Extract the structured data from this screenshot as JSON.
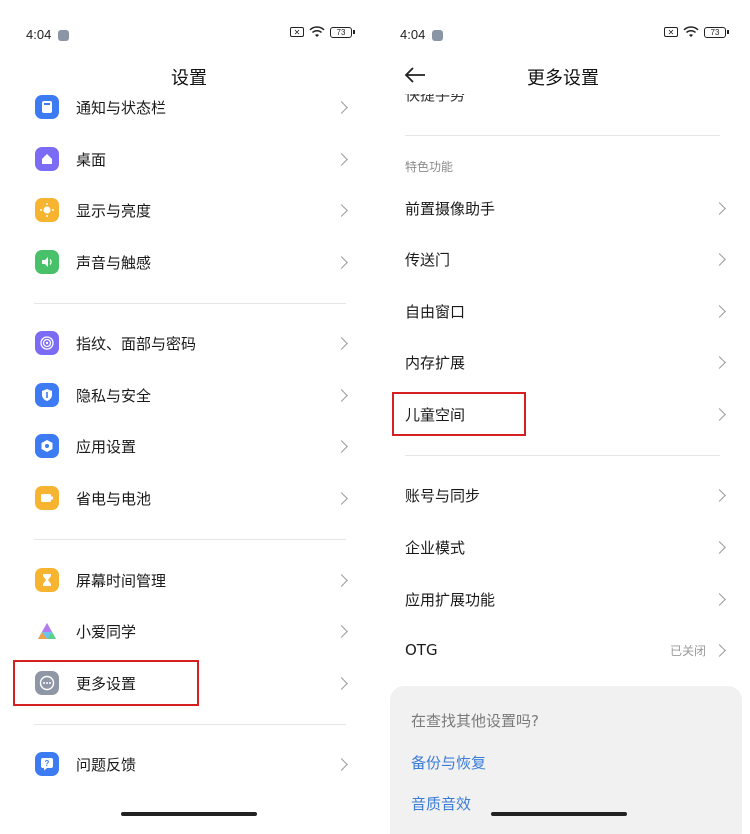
{
  "status": {
    "time": "4:04",
    "battery": "73"
  },
  "left": {
    "title": "设置",
    "groups": [
      [
        {
          "label": "通知与状态栏",
          "icon": "notification-icon",
          "color": "#3d7bf3"
        },
        {
          "label": "桌面",
          "icon": "home-icon",
          "color": "#7c6cf5"
        },
        {
          "label": "显示与亮度",
          "icon": "sun-icon",
          "color": "#f7b431"
        },
        {
          "label": "声音与触感",
          "icon": "speaker-icon",
          "color": "#49c06a"
        }
      ],
      [
        {
          "label": "指纹、面部与密码",
          "icon": "fingerprint-icon",
          "color": "#7c6cf5"
        },
        {
          "label": "隐私与安全",
          "icon": "shield-icon",
          "color": "#3d7bf3"
        },
        {
          "label": "应用设置",
          "icon": "app-settings-icon",
          "color": "#3d7bf3"
        },
        {
          "label": "省电与电池",
          "icon": "battery-icon",
          "color": "#f7b431"
        }
      ],
      [
        {
          "label": "屏幕时间管理",
          "icon": "hourglass-icon",
          "color": "#f7b431"
        },
        {
          "label": "小爱同学",
          "icon": "xiaoai-icon",
          "color": "#ffffff"
        },
        {
          "label": "更多设置",
          "icon": "more-icon",
          "color": "#8f96a6"
        }
      ],
      [
        {
          "label": "问题反馈",
          "icon": "feedback-icon",
          "color": "#3d7bf3"
        }
      ]
    ]
  },
  "right": {
    "title": "更多设置",
    "cut_item": "快捷手势",
    "section_label": "特色功能",
    "items": [
      {
        "label": "前置摄像助手"
      },
      {
        "label": "传送门"
      },
      {
        "label": "自由窗口"
      },
      {
        "label": "内存扩展"
      },
      {
        "label": "儿童空间"
      }
    ],
    "items2": [
      {
        "label": "账号与同步"
      },
      {
        "label": "企业模式"
      },
      {
        "label": "应用扩展功能"
      },
      {
        "label": "OTG",
        "value": "已关闭"
      }
    ],
    "card": {
      "question": "在查找其他设置吗?",
      "links": [
        "备份与恢复",
        "音质音效"
      ]
    }
  },
  "colors": {
    "highlight": "#d62020",
    "link": "#3a7cd8"
  }
}
